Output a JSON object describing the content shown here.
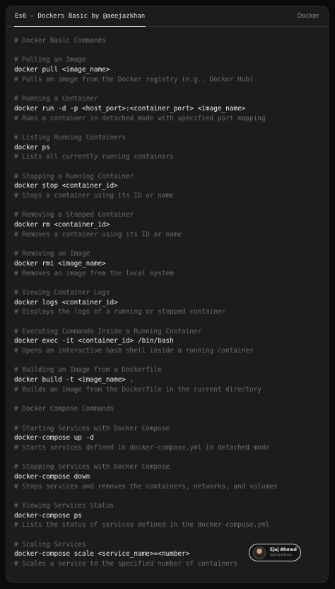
{
  "header": {
    "tab_title": "Es6 - Dockers Basic by @aeejazkhan",
    "language": "Docker"
  },
  "code_lines": [
    {
      "type": "comment",
      "text": "# Docker Basic Commands"
    },
    {
      "type": "blank",
      "text": ""
    },
    {
      "type": "comment",
      "text": "# Pulling an Image"
    },
    {
      "type": "cmd",
      "text": "docker pull <image_name>"
    },
    {
      "type": "comment",
      "text": "# Pulls an image from the Docker registry (e.g., Docker Hub)"
    },
    {
      "type": "blank",
      "text": ""
    },
    {
      "type": "comment",
      "text": "# Running a Container"
    },
    {
      "type": "cmd",
      "text": "docker run -d -p <host_port>:<container_port> <image_name>"
    },
    {
      "type": "comment",
      "text": "# Runs a container in detached mode with specified port mapping"
    },
    {
      "type": "blank",
      "text": ""
    },
    {
      "type": "comment",
      "text": "# Listing Running Containers"
    },
    {
      "type": "cmd",
      "text": "docker ps"
    },
    {
      "type": "comment",
      "text": "# Lists all currently running containers"
    },
    {
      "type": "blank",
      "text": ""
    },
    {
      "type": "comment",
      "text": "# Stopping a Running Container"
    },
    {
      "type": "cmd",
      "text": "docker stop <container_id>"
    },
    {
      "type": "comment",
      "text": "# Stops a container using its ID or name"
    },
    {
      "type": "blank",
      "text": ""
    },
    {
      "type": "comment",
      "text": "# Removing a Stopped Container"
    },
    {
      "type": "cmd",
      "text": "docker rm <container_id>"
    },
    {
      "type": "comment",
      "text": "# Removes a container using its ID or name"
    },
    {
      "type": "blank",
      "text": ""
    },
    {
      "type": "comment",
      "text": "# Removing an Image"
    },
    {
      "type": "cmd",
      "text": "docker rmi <image_name>"
    },
    {
      "type": "comment",
      "text": "# Removes an image from the local system"
    },
    {
      "type": "blank",
      "text": ""
    },
    {
      "type": "comment",
      "text": "# Viewing Container Logs"
    },
    {
      "type": "cmd",
      "text": "docker logs <container_id>"
    },
    {
      "type": "comment",
      "text": "# Displays the logs of a running or stopped container"
    },
    {
      "type": "blank",
      "text": ""
    },
    {
      "type": "comment",
      "text": "# Executing Commands Inside a Running Container"
    },
    {
      "type": "cmd",
      "text": "docker exec -it <container_id> /bin/bash"
    },
    {
      "type": "comment",
      "text": "# Opens an interactive bash shell inside a running container"
    },
    {
      "type": "blank",
      "text": ""
    },
    {
      "type": "comment",
      "text": "# Building an Image from a Dockerfile"
    },
    {
      "type": "cmd",
      "text": "docker build -t <image_name> ."
    },
    {
      "type": "comment",
      "text": "# Builds an image from the Dockerfile in the current directory"
    },
    {
      "type": "blank",
      "text": ""
    },
    {
      "type": "comment",
      "text": "# Docker Compose Commands"
    },
    {
      "type": "blank",
      "text": ""
    },
    {
      "type": "comment",
      "text": "# Starting Services with Docker Compose"
    },
    {
      "type": "cmd",
      "text": "docker-compose up -d"
    },
    {
      "type": "comment",
      "text": "# Starts services defined in docker-compose.yml in detached mode"
    },
    {
      "type": "blank",
      "text": ""
    },
    {
      "type": "comment",
      "text": "# Stopping Services with Docker Compose"
    },
    {
      "type": "cmd",
      "text": "docker-compose down"
    },
    {
      "type": "comment",
      "text": "# Stops services and removes the containers, networks, and volumes"
    },
    {
      "type": "blank",
      "text": ""
    },
    {
      "type": "comment",
      "text": "# Viewing Services Status"
    },
    {
      "type": "cmd",
      "text": "docker-compose ps"
    },
    {
      "type": "comment",
      "text": "# Lists the status of services defined in the docker-compose.yml"
    },
    {
      "type": "blank",
      "text": ""
    },
    {
      "type": "comment",
      "text": "# Scaling Services"
    },
    {
      "type": "cmd",
      "text": "docker-compose scale <service_name>=<number>"
    },
    {
      "type": "comment",
      "text": "# Scales a service to the specified number of containers"
    }
  ],
  "author_badge": {
    "name": "Ejaj Ahmed",
    "handle": "@aeejazkhan"
  },
  "colors": {
    "background": "#0b0b0b",
    "panel": "#1c1c1c",
    "comment": "#6d6d6d",
    "command": "#f0f0f0"
  }
}
